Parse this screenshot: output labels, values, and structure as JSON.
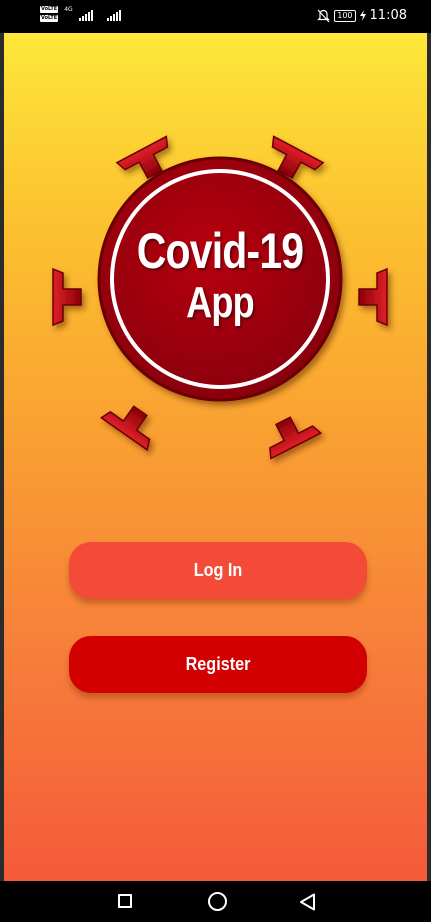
{
  "status_bar": {
    "volte_1": "VoLTE",
    "volte_2": "VoLTE",
    "network": "4G",
    "battery": "100",
    "time": "11:08",
    "icons": [
      "mute-bell-icon",
      "battery-icon",
      "charging-icon"
    ]
  },
  "logo": {
    "line1": "Covid-19",
    "line2": "App",
    "colors": {
      "badge": "#a8000c",
      "ring": "#ffffff",
      "spike": "#c20010"
    }
  },
  "buttons": {
    "login": "Log In",
    "register": "Register"
  },
  "nav_bar": {
    "icons": [
      "recents-square-icon",
      "home-circle-icon",
      "back-triangle-icon"
    ]
  },
  "colors": {
    "gradient_top": "#fde73a",
    "gradient_bottom": "#f45a3a",
    "login_button": "#f44b38",
    "register_button": "#d20000"
  }
}
